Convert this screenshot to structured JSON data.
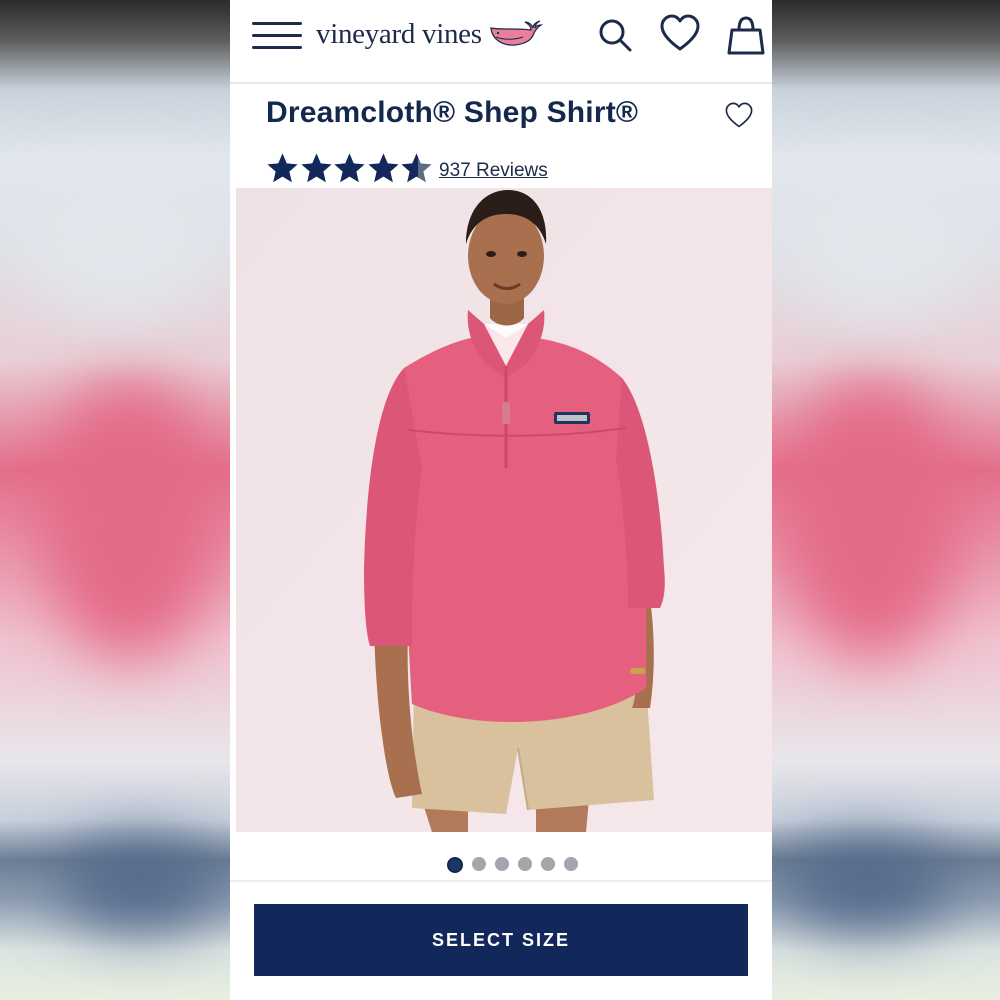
{
  "header": {
    "brand": "vineyard vines",
    "menu_icon": "hamburger-menu-icon",
    "whale_icon": "whale-logo-icon",
    "search_icon": "search-icon",
    "wishlist_icon": "heart-icon",
    "bag_icon": "shopping-bag-icon"
  },
  "product": {
    "title": "Dreamcloth® Shep Shirt®",
    "rating": 4.5,
    "rating_max": 5,
    "reviews_label": "937 Reviews",
    "image_description_icon": "product-photo",
    "gallery_count": 6,
    "gallery_active_index": 0
  },
  "actions": {
    "select_size_label": "SELECT SIZE"
  },
  "colors": {
    "navy": "#13285a",
    "whale_pink": "#e87f9c",
    "shirt_pink": "#e5607f",
    "shorts_khaki": "#d9c19e"
  }
}
